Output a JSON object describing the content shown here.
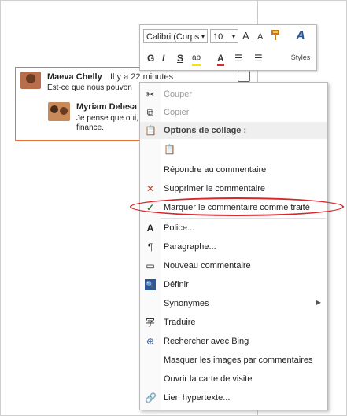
{
  "toolbar": {
    "font_name": "Calibri (Corps",
    "font_size": "10",
    "grow_label": "A",
    "shrink_label": "A",
    "bold_label": "G",
    "italic_label": "I",
    "underline_label": "S",
    "highlight_label": "ab",
    "font_color_label": "A",
    "styles_label": "Styles",
    "styles_glyph": "A"
  },
  "comments": [
    {
      "author": "Maeva Chelly",
      "time": "Il y a 22 minutes",
      "text": "Est-ce que nous pouvon"
    },
    {
      "author": "Myriam Delesa",
      "text_line1": "Je pense que oui,",
      "text_line2": "finance."
    }
  ],
  "context_menu": {
    "items": [
      {
        "label": "Couper",
        "icon": "scissors-icon",
        "disabled": true
      },
      {
        "label": "Copier",
        "icon": "copy-icon",
        "disabled": true
      },
      {
        "label": "Options de collage :",
        "icon": "paste-icon",
        "header": true
      },
      {
        "label": "",
        "icon": "paste-option-icon"
      },
      {
        "label": "Répondre au commentaire",
        "icon": ""
      },
      {
        "label": "Supprimer le commentaire",
        "icon": "delete-comment-icon"
      },
      {
        "label": "Marquer le commentaire comme traité",
        "icon": "checkmark-icon"
      },
      {
        "label": "Police...",
        "icon": "font-icon"
      },
      {
        "label": "Paragraphe...",
        "icon": "paragraph-icon"
      },
      {
        "label": "Nouveau commentaire",
        "icon": "new-comment-icon"
      },
      {
        "label": "Définir",
        "icon": "define-icon"
      },
      {
        "label": "Synonymes",
        "icon": "",
        "submenu": true
      },
      {
        "label": "Traduire",
        "icon": "translate-icon"
      },
      {
        "label": "Rechercher avec Bing",
        "icon": "search-globe-icon"
      },
      {
        "label": "Masquer les images par commentaires",
        "icon": ""
      },
      {
        "label": "Ouvrir la carte de visite",
        "icon": ""
      },
      {
        "label": "Lien hypertexte...",
        "icon": "hyperlink-icon"
      }
    ]
  },
  "colors": {
    "comment_border": "#e8743b",
    "highlight_ring": "#d8262d",
    "check_green": "#3a7d3a",
    "accent_blue": "#2b579a"
  }
}
